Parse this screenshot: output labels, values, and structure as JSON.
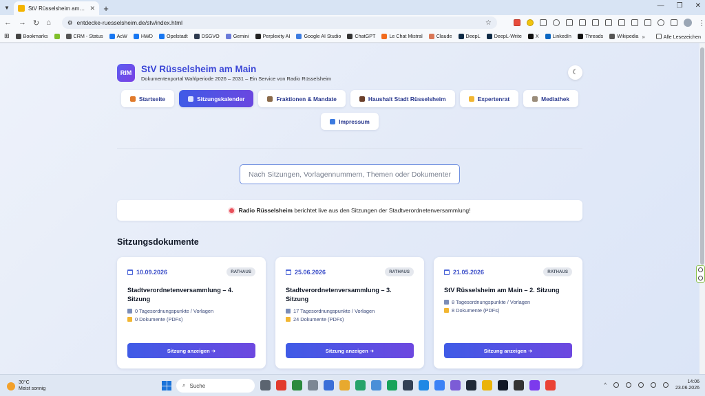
{
  "browser": {
    "tab_title": "StV Rüsselsheim am Main – Dokumentenportal",
    "url": "entdecke-ruesselsheim.de/stv/index.html",
    "bookmarks": [
      {
        "label": "Bookmarks",
        "color": "#444444"
      },
      {
        "label": "",
        "color": "#7fbf2a"
      },
      {
        "label": "CRM - Status",
        "color": "#555555"
      },
      {
        "label": "AcW",
        "color": "#1877f2"
      },
      {
        "label": "HWD",
        "color": "#1877f2"
      },
      {
        "label": "Opelstadt",
        "color": "#1877f2"
      },
      {
        "label": "DSGVO",
        "color": "#2e3a4f"
      },
      {
        "label": "Gemini",
        "color": "#6b7bd9"
      },
      {
        "label": "Perplexity AI",
        "color": "#222222"
      },
      {
        "label": "Google AI Studio",
        "color": "#3b7be0"
      },
      {
        "label": "ChatGPT",
        "color": "#333333"
      },
      {
        "label": "Le Chat Mistral",
        "color": "#f26b1d"
      },
      {
        "label": "Claude",
        "color": "#d97757"
      },
      {
        "label": "DeepL",
        "color": "#0f2b46"
      },
      {
        "label": "DeepL-Write",
        "color": "#0f2b46"
      },
      {
        "label": "X",
        "color": "#111111"
      },
      {
        "label": "LinkedIn",
        "color": "#0a66c2"
      },
      {
        "label": "Threads",
        "color": "#111111"
      },
      {
        "label": "Wikipedia",
        "color": "#555555"
      }
    ],
    "all_bookmarks_label": "Alle Lesezeichen",
    "more_label": "»"
  },
  "site": {
    "logo_text": "RIM",
    "title": "StV Rüsselsheim am Main",
    "subtitle": "Dokumentenportal Wahlperiode 2026 – 2031 – Ein Service von Radio Rüsselsheim",
    "theme_icon": "☾"
  },
  "nav": {
    "row1": [
      {
        "label": "Startseite",
        "icon_color": "#e07a2b",
        "active": false
      },
      {
        "label": "Sitzungskalender",
        "icon_color": "#dbe3ff",
        "active": true
      },
      {
        "label": "Fraktionen & Mandate",
        "icon_color": "#8a6a4a",
        "active": false
      },
      {
        "label": "Haushalt Stadt Rüsselsheim",
        "icon_color": "#6b3f2a",
        "active": false
      },
      {
        "label": "Expertenrat",
        "icon_color": "#f2b632",
        "active": false
      },
      {
        "label": "Mediathek",
        "icon_color": "#9a8c7a",
        "active": false
      }
    ],
    "row2": [
      {
        "label": "Impressum",
        "icon_color": "#3d7be0",
        "active": false
      }
    ]
  },
  "search": {
    "placeholder": "Nach Sitzungen, Vorlagennummern, Themen oder Dokumenten suchen..."
  },
  "live_banner": {
    "brand": "Radio Rüsselsheim",
    "text": " berichtet live aus den Sitzungen der Stadtverordnetenversammlung!"
  },
  "section": {
    "title": "Sitzungsdokumente"
  },
  "cards": [
    {
      "date": "10.09.2026",
      "badge": "RATHAUS",
      "title": "Stadtverordnetenversammlung – 4. Sitzung",
      "agenda": "0 Tagesordnungspunkte / Vorlagen",
      "docs": "0 Dokumente (PDFs)",
      "button": "Sitzung anzeigen ➜"
    },
    {
      "date": "25.06.2026",
      "badge": "RATHAUS",
      "title": "Stadtverordnetenversammlung – 3. Sitzung",
      "agenda": "17 Tagesordnungspunkte / Vorlagen",
      "docs": "24 Dokumente (PDFs)",
      "button": "Sitzung anzeigen ➜"
    },
    {
      "date": "21.05.2026",
      "badge": "RATHAUS",
      "title": "StV Rüsselsheim am Main – 2. Sitzung",
      "agenda": "8 Tagesordnungspunkte / Vorlagen",
      "docs": "8 Dokumente (PDFs)",
      "button": "Sitzung anzeigen ➜"
    }
  ],
  "taskbar": {
    "weather_temp": "30°C",
    "weather_text": "Meist sonnig",
    "search_label": "Suche",
    "time": "14:06",
    "date": "23.06.2026",
    "apps": [
      "#5b6470",
      "#e23b2e",
      "#2b8a3e",
      "#7c8794",
      "#3a6fd8",
      "#e8a92e",
      "#27a36a",
      "#4a8fd8",
      "#17a35a",
      "#334155",
      "#1e88e5",
      "#3b82f6",
      "#7c5cd6",
      "#1f2937",
      "#eab308",
      "#111827",
      "#333333",
      "#7c3aed",
      "#ea4335"
    ]
  },
  "colors": {
    "accent": "#3f5be6",
    "accent2": "#6d48e0",
    "title_blue": "#3b46d6"
  }
}
